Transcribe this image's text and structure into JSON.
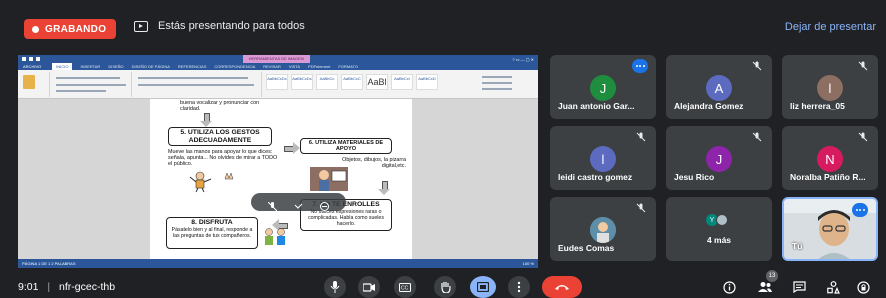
{
  "topbar": {
    "recording_label": "GRABANDO",
    "presenting_text": "Estás presentando para todos",
    "stop_presenting": "Dejar de presentar"
  },
  "shared_screen": {
    "ribbon_tabs": [
      "ARCHIVO",
      "INICIO",
      "INSERTAR",
      "DISEÑO",
      "DISEÑO DE PÁGINA",
      "REFERENCIAS",
      "CORRESPONDENCIA",
      "REVISAR",
      "VISTA",
      "PDFelement",
      "FORMATO"
    ],
    "context_tab": "HERRAMIENTAS DE IMAGEN",
    "styles": [
      "AaBbCcDc",
      "AaBbCcDc",
      "AaBbCc",
      "AaBbCcC",
      "AaBl",
      "AaBbCcI",
      "AaBbCcD"
    ],
    "doc": {
      "top_fragment": "buena vocalizar y pronunciar con claridad.",
      "step5_title": "5. UTILIZA LOS GESTOS ADECUADAMENTE",
      "step5_body": "Mueve las manos para apoyar lo que dices: señala, apunta... No olvides de mirar a TODO el público.",
      "step6_title": "6. UTILIZA MATERIALES DE APOYO",
      "step6_body": "Objetos, dibujos, la pizarra digital,etc.",
      "step7_title": "7. NO TE ENROLLES",
      "step7_body": "No utilices expresiones raras o complicadas. Habla como sueles hacerlo.",
      "step8_title": "8. DISFRUTA",
      "step8_body": "Pásatelo bien y al final, responde a las preguntas de tus compañeros."
    },
    "status_left": "PÁGINA 1 DE 1   2 PALABRAS",
    "status_right": "100 %"
  },
  "participants": [
    {
      "name": "Juan antonio Gar...",
      "initial": "J",
      "color": "#1e8e3e",
      "has_menu": true
    },
    {
      "name": "Alejandra Gomez",
      "initial": "A",
      "color": "#5c6bc0",
      "has_menu": false
    },
    {
      "name": "liz herrera_05",
      "initial": "l",
      "color": "#8d6e63",
      "has_menu": false
    },
    {
      "name": "leidi castro gomez",
      "initial": "l",
      "color": "#5c6bc0",
      "has_menu": false
    },
    {
      "name": "Jesu Rico",
      "initial": "J",
      "color": "#8e24aa",
      "has_menu": false
    },
    {
      "name": "Noralba Patiño R...",
      "initial": "N",
      "color": "#d81b60",
      "has_menu": false
    },
    {
      "name": "Eudes Comas",
      "initial": "",
      "color": "#4b7f9a",
      "has_menu": false
    },
    {
      "name": "4 más",
      "initial": "Y",
      "color": "#00897b",
      "has_menu": false
    },
    {
      "name": "Tú",
      "initial": "",
      "color": "#cfd8dc",
      "has_menu": true
    }
  ],
  "bottombar": {
    "time": "9:01",
    "separator": "|",
    "meeting_code": "nfr-gcec-thb",
    "participant_count": "13"
  },
  "icons": [
    "mic-icon",
    "camera-icon",
    "captions-icon",
    "raise-hand-icon",
    "present-icon",
    "more-options-icon",
    "hang-up-icon",
    "info-icon",
    "people-icon",
    "chat-icon",
    "activities-icon",
    "lock-icon"
  ],
  "colors": {
    "background": "#202124",
    "record": "#ea4335",
    "accent": "#8ab4f8",
    "tile": "#3c4043"
  }
}
